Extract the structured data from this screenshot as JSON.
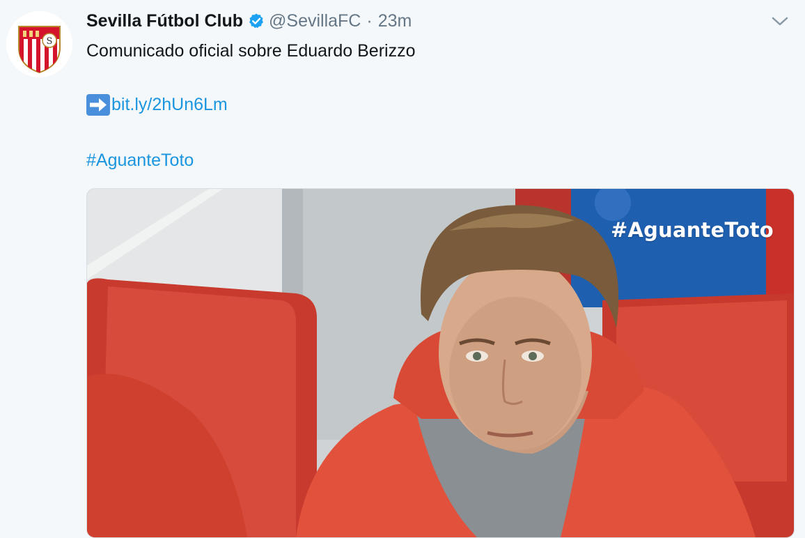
{
  "tweet": {
    "author_name": "Sevilla Fútbol Club",
    "author_handle": "@SevillaFC",
    "separator": "·",
    "time_ago": "23m",
    "text_line": "Comunicado oficial sobre Eduardo Berizzo",
    "link_text": "bit.ly/2hUn6Lm",
    "hashtag": "#AguanteToto"
  },
  "media": {
    "overlay_text": "#AguanteToto",
    "description_icon": "photo"
  },
  "icons": {
    "avatar": "sevilla-crest-icon",
    "verified": "verified-badge-icon",
    "caret": "chevron-down-icon",
    "arrow": "right-arrow-emoji-icon"
  },
  "colors": {
    "background": "#f5f8fa",
    "link": "#1b95e0",
    "muted": "#657786",
    "verified": "#1da1f2",
    "crest_red": "#d3142b"
  }
}
